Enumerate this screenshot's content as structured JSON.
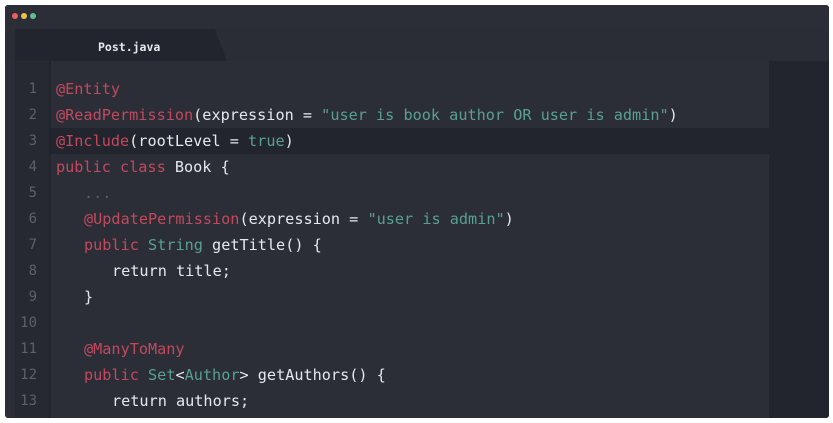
{
  "window": {
    "traffic_lights": [
      {
        "name": "close",
        "color": "#ec5f5f"
      },
      {
        "name": "minimize",
        "color": "#f1c04b"
      },
      {
        "name": "maximize",
        "color": "#5cc28e"
      }
    ]
  },
  "tab": {
    "label": "Post.java"
  },
  "colors": {
    "annotation": "#c2495d",
    "string": "#58a091",
    "keyword": "#c2495d",
    "text": "#e6e8ee",
    "line_number": "#5c606c",
    "background": "#2b2e37"
  },
  "editor": {
    "highlighted_lines": [
      3
    ],
    "lines": [
      {
        "n": "1",
        "indent": 0,
        "tokens": [
          {
            "t": "@Entity",
            "c": "ann"
          }
        ]
      },
      {
        "n": "2",
        "indent": 0,
        "tokens": [
          {
            "t": "@ReadPermission",
            "c": "ann"
          },
          {
            "t": "(expression = ",
            "c": ""
          },
          {
            "t": "\"user is book author OR user is admin\"",
            "c": "str"
          },
          {
            "t": ")",
            "c": ""
          }
        ]
      },
      {
        "n": "3",
        "indent": 0,
        "tokens": [
          {
            "t": "@Include",
            "c": "ann"
          },
          {
            "t": "(rootLevel = ",
            "c": ""
          },
          {
            "t": "true",
            "c": "bool"
          },
          {
            "t": ")",
            "c": ""
          }
        ]
      },
      {
        "n": "4",
        "indent": 0,
        "tokens": [
          {
            "t": "public class",
            "c": "kw"
          },
          {
            "t": " Book {",
            "c": ""
          }
        ]
      },
      {
        "n": "5",
        "indent": 1,
        "tokens": [
          {
            "t": "...",
            "c": "dots"
          }
        ]
      },
      {
        "n": "6",
        "indent": 1,
        "tokens": [
          {
            "t": "@UpdatePermission",
            "c": "ann"
          },
          {
            "t": "(expression = ",
            "c": ""
          },
          {
            "t": "\"user is admin\"",
            "c": "str"
          },
          {
            "t": ")",
            "c": ""
          }
        ]
      },
      {
        "n": "7",
        "indent": 1,
        "tokens": [
          {
            "t": "public",
            "c": "kw"
          },
          {
            "t": " ",
            "c": ""
          },
          {
            "t": "String",
            "c": "ty"
          },
          {
            "t": " getTitle() {",
            "c": ""
          }
        ]
      },
      {
        "n": "8",
        "indent": 2,
        "tokens": [
          {
            "t": "return title;",
            "c": ""
          }
        ]
      },
      {
        "n": "9",
        "indent": 1,
        "tokens": [
          {
            "t": "}",
            "c": ""
          }
        ]
      },
      {
        "n": "10",
        "indent": 0,
        "tokens": []
      },
      {
        "n": "11",
        "indent": 1,
        "tokens": [
          {
            "t": "@ManyToMany",
            "c": "ann"
          }
        ]
      },
      {
        "n": "12",
        "indent": 1,
        "tokens": [
          {
            "t": "public",
            "c": "kw"
          },
          {
            "t": " ",
            "c": ""
          },
          {
            "t": "Set",
            "c": "ty"
          },
          {
            "t": "<",
            "c": ""
          },
          {
            "t": "Author",
            "c": "ty"
          },
          {
            "t": "> getAuthors() {",
            "c": ""
          }
        ]
      },
      {
        "n": "13",
        "indent": 2,
        "tokens": [
          {
            "t": "return authors;",
            "c": ""
          }
        ]
      }
    ]
  }
}
